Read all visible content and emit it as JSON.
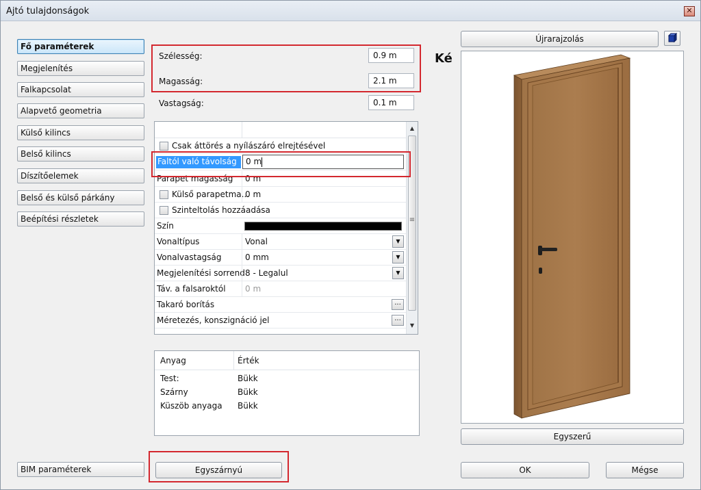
{
  "window": {
    "title": "Ajtó tulajdonságok",
    "close_symbol": "✕"
  },
  "nav": {
    "items": [
      {
        "label": "Fő paraméterek",
        "active": true
      },
      {
        "label": "Megjelenítés"
      },
      {
        "label": "Falkapcsolat"
      },
      {
        "label": "Alapvető geometria"
      },
      {
        "label": "Külső kilincs"
      },
      {
        "label": "Belső kilincs"
      },
      {
        "label": "Díszítőelemek"
      },
      {
        "label": "Belső és külső párkány"
      },
      {
        "label": "Beépítési részletek"
      }
    ],
    "bim_label": "BIM paraméterek"
  },
  "params": {
    "width_label": "Szélesség:",
    "width_value": "0.9 m",
    "height_label": "Magasság:",
    "height_value": "2.1 m",
    "thickness_label": "Vastagság:",
    "thickness_value": "0.1 m"
  },
  "grid": {
    "rows": {
      "cut_label": "Csak áttörés a nyílászáró elrejtésével",
      "wall_dist_label": "Faltól való távolság",
      "wall_dist_value": "0 m",
      "parapet_label": "Parapet magasság",
      "parapet_value": "0 m",
      "ext_parapet_label": "Külső parapetma...",
      "ext_parapet_value": "0 m",
      "leveling_label": "Szinteltolás hozzáadása",
      "color_label": "Szín",
      "color_value": "#000000",
      "linetype_label": "Vonaltípus",
      "linetype_value": "Vonal",
      "linewidth_label": "Vonalvastagság",
      "linewidth_value": "0 mm",
      "order_label": "Megjelenítési sorrend",
      "order_value": "8 - Legalul",
      "rebate_label": "Táv. a falsaroktól",
      "rebate_value": "0 m",
      "cover_label": "Takaró borítás",
      "dim_label": "Méretezés, konszignáció jel"
    },
    "dropdown_arrow": "▼",
    "ellipsis": "...",
    "scroll_up": "▲",
    "scroll_down": "▼",
    "scroll_grip": "≡"
  },
  "materials": {
    "col_material": "Anyag",
    "col_value": "Érték",
    "rows": [
      {
        "name": "Test:",
        "value": "Bükk"
      },
      {
        "name": "Szárny",
        "value": "Bükk"
      },
      {
        "name": "Küszöb anyaga",
        "value": "Bükk"
      }
    ]
  },
  "buttons": {
    "door_type": "Egyszárnyú",
    "redraw": "Újrarajzolás",
    "simple": "Egyszerű",
    "ok": "OK",
    "cancel": "Mégse"
  },
  "preview": {
    "side_text": "Ké"
  },
  "colors": {
    "door_wood": "#9e7045",
    "highlight": "#d3272e",
    "selection": "#3399ff"
  }
}
